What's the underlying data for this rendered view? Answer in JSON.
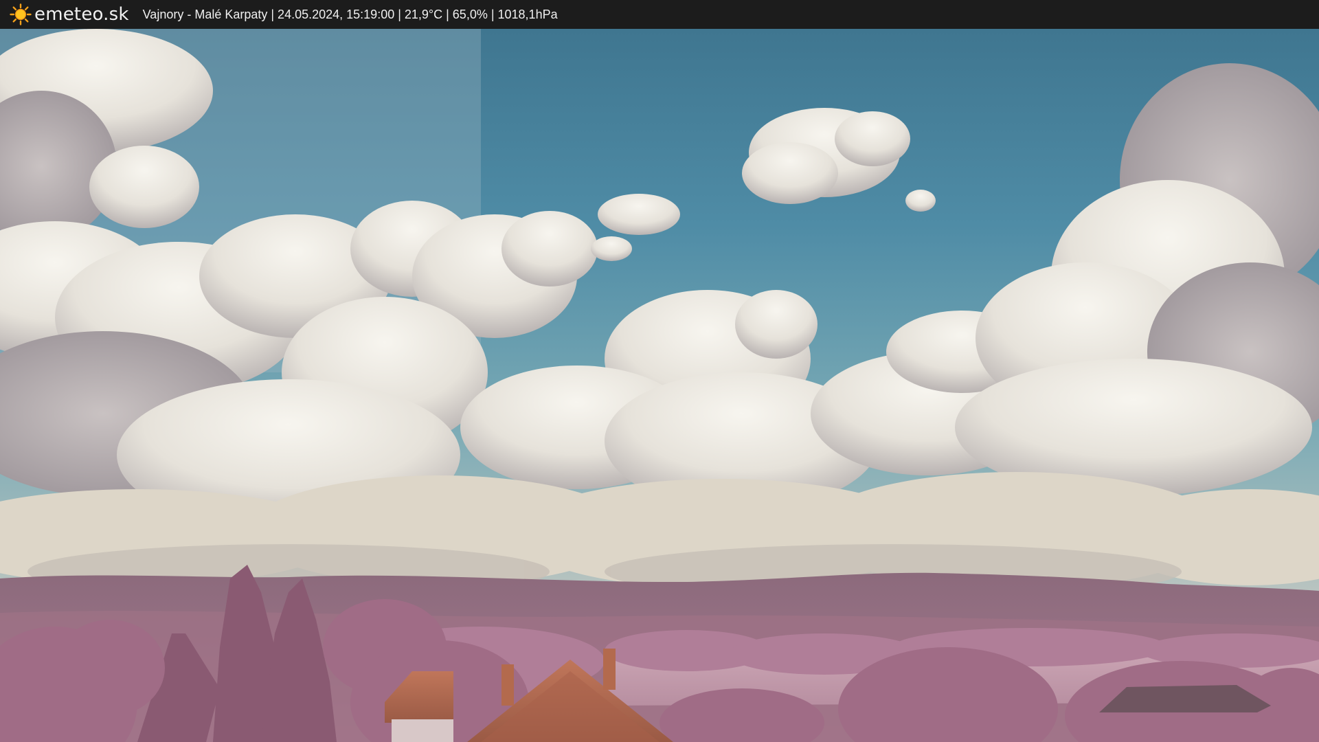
{
  "header": {
    "brand": "emeteo.sk",
    "logo_icon": "sun-icon",
    "caption": "Vajnory - Malé Karpaty | 24.05.2024, 15:19:00 | 21,9°C | 65,0% | 1018,1hPa"
  },
  "colors": {
    "bar_background": "#1c1c1c",
    "sky_top": "#4b7f9a",
    "sky_mid": "#5b98ae",
    "cloud": "#eeebe4",
    "hills": "#9c7488",
    "vegetation": "#b07e98",
    "roof": "#b4674a"
  }
}
